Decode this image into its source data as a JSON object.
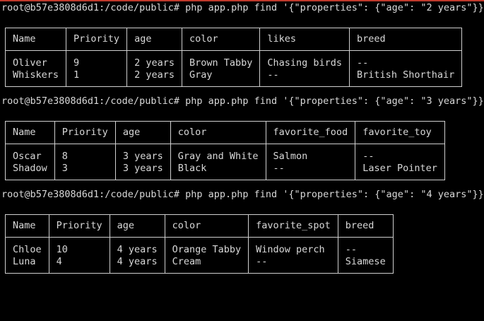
{
  "blocks": [
    {
      "command": "root@b57e3808d6d1:/code/public# php app.php find '{\"properties\": {\"age\": \"2 years\"}}'",
      "headers": [
        "Name",
        "Priority",
        "age",
        "color",
        "likes",
        "breed"
      ],
      "rows": [
        [
          "Oliver",
          "9",
          "2 years",
          "Brown Tabby",
          "Chasing birds",
          "--"
        ],
        [
          "Whiskers",
          "1",
          "2 years",
          "Gray",
          "--",
          "British Shorthair"
        ]
      ]
    },
    {
      "command": "root@b57e3808d6d1:/code/public# php app.php find '{\"properties\": {\"age\": \"3 years\"}}'",
      "headers": [
        "Name",
        "Priority",
        "age",
        "color",
        "favorite_food",
        "favorite_toy"
      ],
      "rows": [
        [
          "Oscar",
          "8",
          "3 years",
          "Gray and White",
          "Salmon",
          "--"
        ],
        [
          "Shadow",
          "3",
          "3 years",
          "Black",
          "--",
          "Laser Pointer"
        ]
      ]
    },
    {
      "command": "root@b57e3808d6d1:/code/public# php app.php find '{\"properties\": {\"age\": \"4 years\"}}'",
      "headers": [
        "Name",
        "Priority",
        "age",
        "color",
        "favorite_spot",
        "breed"
      ],
      "rows": [
        [
          "Chloe",
          "10",
          "4 years",
          "Orange Tabby",
          "Window perch",
          "--"
        ],
        [
          "Luna",
          "4",
          "4 years",
          "Cream",
          "--",
          "Siamese"
        ]
      ]
    }
  ]
}
